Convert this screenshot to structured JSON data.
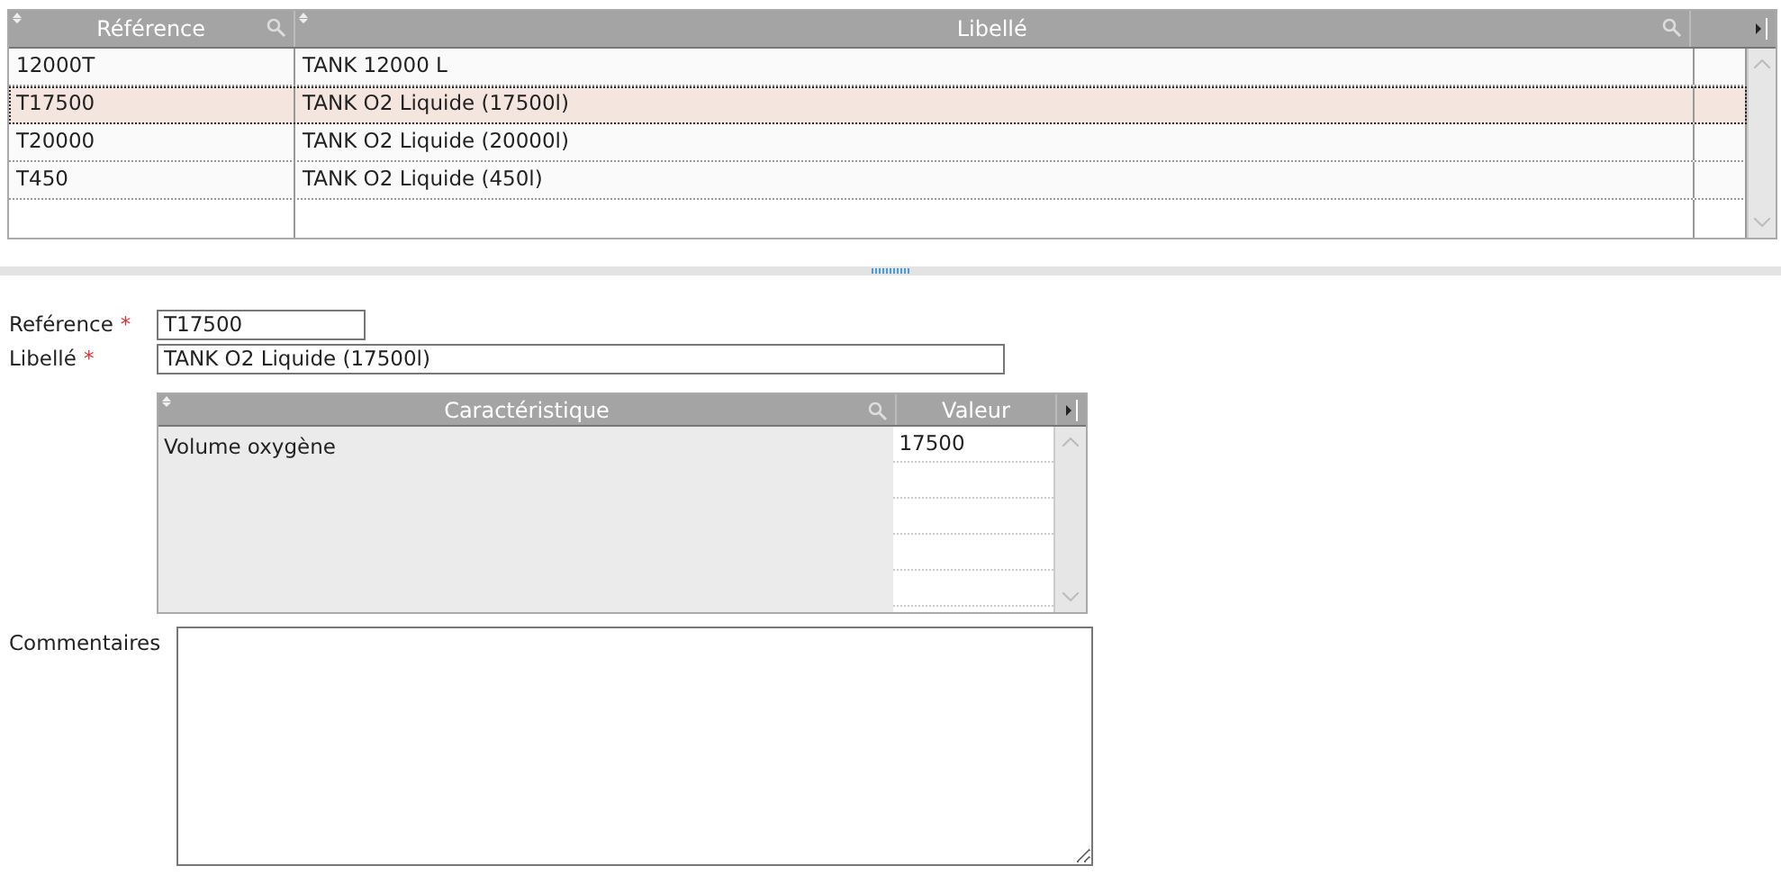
{
  "list": {
    "columns": [
      {
        "label": "Référence"
      },
      {
        "label": "Libellé"
      }
    ],
    "rows": [
      {
        "cells": [
          "12000T",
          "TANK 12000 L"
        ],
        "selected": false
      },
      {
        "cells": [
          "T17500",
          "TANK O2 Liquide (17500l)"
        ],
        "selected": true
      },
      {
        "cells": [
          "T20000",
          "TANK O2 Liquide (20000l)"
        ],
        "selected": false
      },
      {
        "cells": [
          "T450",
          "TANK O2 Liquide (450l)"
        ],
        "selected": false
      }
    ]
  },
  "form": {
    "fields": [
      {
        "label": "Reférence",
        "required_mark": "*",
        "value": "T17500"
      },
      {
        "label": "Libellé",
        "required_mark": "*",
        "value": "TANK O2 Liquide (17500l)"
      }
    ],
    "characteristics": {
      "columns": [
        {
          "label": "Caractéristique"
        },
        {
          "label": "Valeur"
        }
      ],
      "rows": [
        {
          "cells": [
            "Volume oxygène",
            "17500"
          ]
        }
      ]
    },
    "comments": {
      "label": "Commentaires"
    }
  }
}
